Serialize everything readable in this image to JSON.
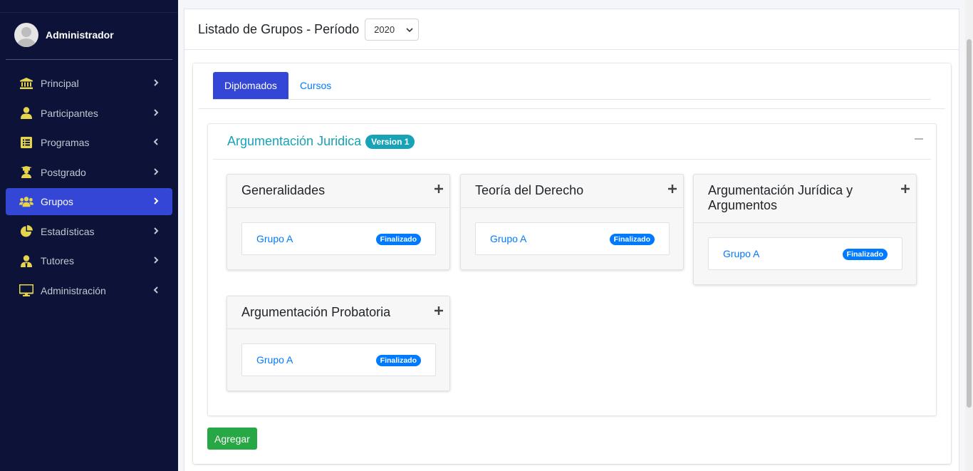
{
  "sidebar": {
    "user_name": "Administrador",
    "items": [
      {
        "label": "Principal",
        "icon": "bank-icon",
        "chevron": "right",
        "active": false
      },
      {
        "label": "Participantes",
        "icon": "user-icon",
        "chevron": "right",
        "active": false
      },
      {
        "label": "Programas",
        "icon": "list-icon",
        "chevron": "left",
        "active": false
      },
      {
        "label": "Postgrado",
        "icon": "graduate-icon",
        "chevron": "right",
        "active": false
      },
      {
        "label": "Grupos",
        "icon": "users-icon",
        "chevron": "right",
        "active": true
      },
      {
        "label": "Estadísticas",
        "icon": "pie-chart-icon",
        "chevron": "right",
        "active": false
      },
      {
        "label": "Tutores",
        "icon": "tutor-icon",
        "chevron": "right",
        "active": false
      },
      {
        "label": "Administración",
        "icon": "desktop-icon",
        "chevron": "left",
        "active": false
      }
    ]
  },
  "header": {
    "title": "Listado de Grupos - Período",
    "period_value": "2020"
  },
  "tabs": [
    {
      "label": "Diplomados",
      "active": true
    },
    {
      "label": "Cursos",
      "active": false
    }
  ],
  "program": {
    "title": "Argumentación Juridica",
    "version": "Version 1",
    "modules": [
      {
        "name": "Generalidades",
        "groups": [
          {
            "name": "Grupo A",
            "status": "Finalizado"
          }
        ]
      },
      {
        "name": "Teoría del Derecho",
        "groups": [
          {
            "name": "Grupo A",
            "status": "Finalizado"
          }
        ]
      },
      {
        "name": "Argumentación Jurídica y Argumentos",
        "groups": [
          {
            "name": "Grupo A",
            "status": "Finalizado"
          }
        ]
      },
      {
        "name": "Argumentación Probatoria",
        "groups": [
          {
            "name": "Grupo A",
            "status": "Finalizado"
          }
        ]
      }
    ]
  },
  "actions": {
    "add_label": "Agregar"
  },
  "colors": {
    "sidebar_bg": "#0d1238",
    "accent": "#3346d6",
    "icon_yellow": "#e4d54c",
    "info": "#17a2b8",
    "link": "#007bff",
    "success": "#28a745"
  }
}
